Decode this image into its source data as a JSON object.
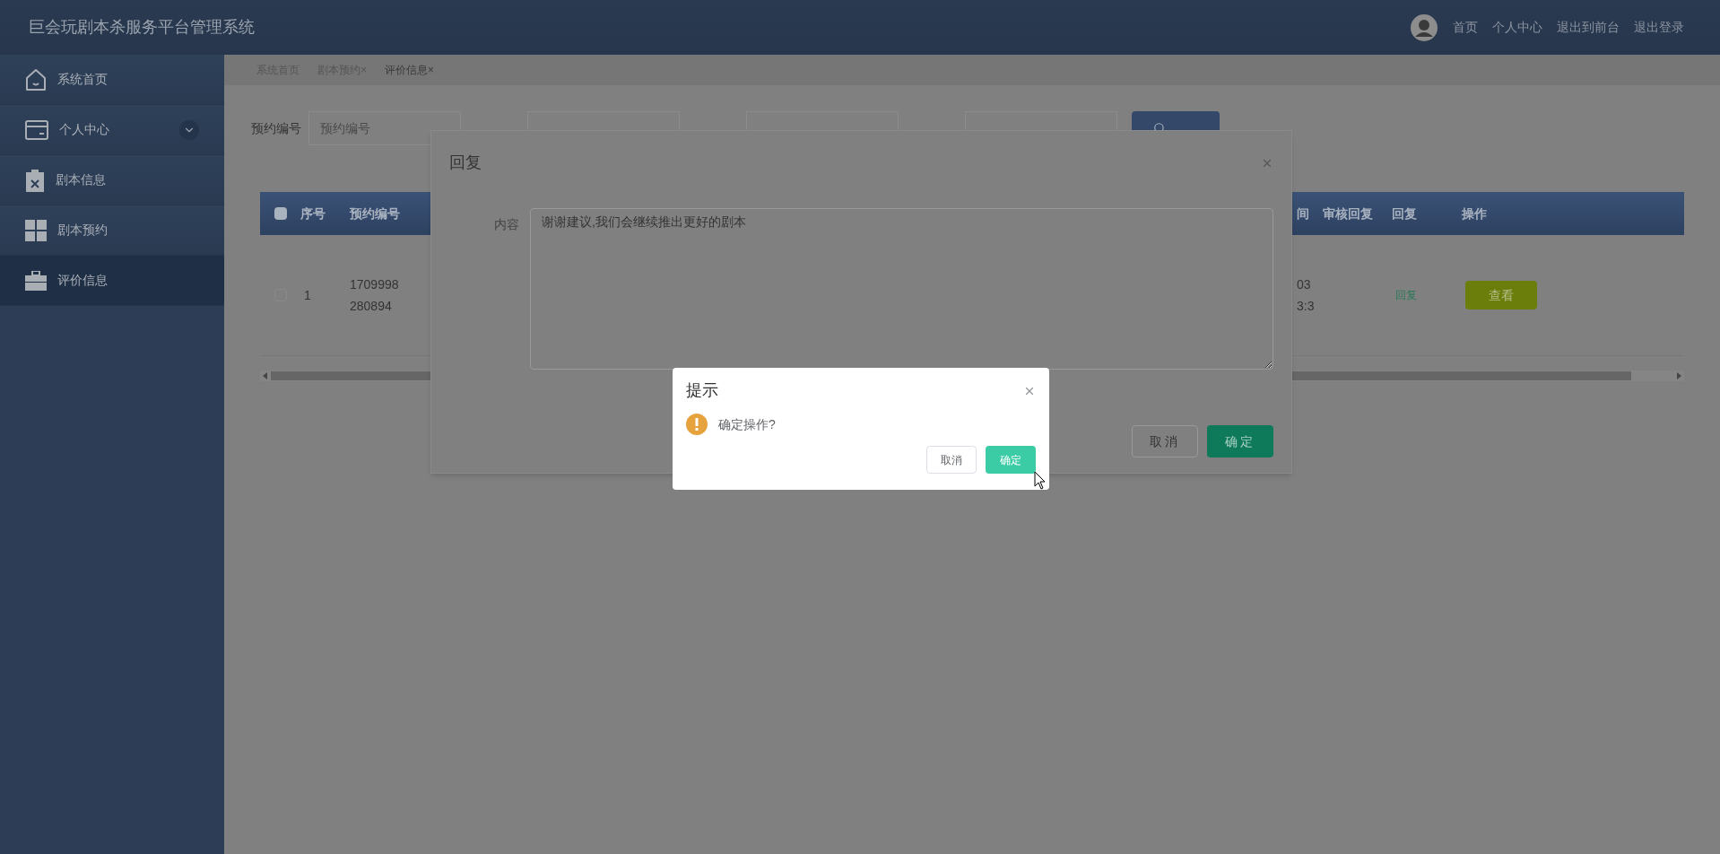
{
  "header": {
    "title": "巨会玩剧本杀服务平台管理系统",
    "nav": [
      "首页",
      "个人中心",
      "退出到前台",
      "退出登录"
    ]
  },
  "sidebar": {
    "items": [
      {
        "label": "系统首页",
        "selected": false,
        "expandable": false
      },
      {
        "label": "个人中心",
        "selected": false,
        "expandable": true
      },
      {
        "label": "剧本信息",
        "selected": false,
        "expandable": false
      },
      {
        "label": "剧本预约",
        "selected": false,
        "expandable": false
      },
      {
        "label": "评价信息",
        "selected": true,
        "expandable": false
      }
    ]
  },
  "breadcrumbs": [
    {
      "label": "系统首页",
      "selected": false
    },
    {
      "label": "剧本预约",
      "close": "×",
      "selected": false
    },
    {
      "label": "评价信息",
      "close": "×",
      "selected": true
    }
  ],
  "search": {
    "fields": [
      {
        "label": "预约编号",
        "placeholder": "预约编号"
      }
    ]
  },
  "table": {
    "columns": [
      "序号",
      "预约编号",
      "间",
      "审核回复",
      "回复",
      "操作"
    ],
    "header_checked": false,
    "rows": [
      {
        "checked": false,
        "cells": [
          "1",
          "1709998280894",
          "03\n3:3"
        ],
        "reply_link": "回复",
        "action": "查看"
      }
    ]
  },
  "reply_dialog": {
    "title": "回复",
    "field_label": "内容",
    "value": "谢谢建议,我们会继续推出更好的剧本",
    "buttons": [
      "取消",
      "确定"
    ]
  },
  "confirm_dialog": {
    "title": "提示",
    "message": "确定操作?",
    "buttons": [
      "取消",
      "确定"
    ]
  }
}
